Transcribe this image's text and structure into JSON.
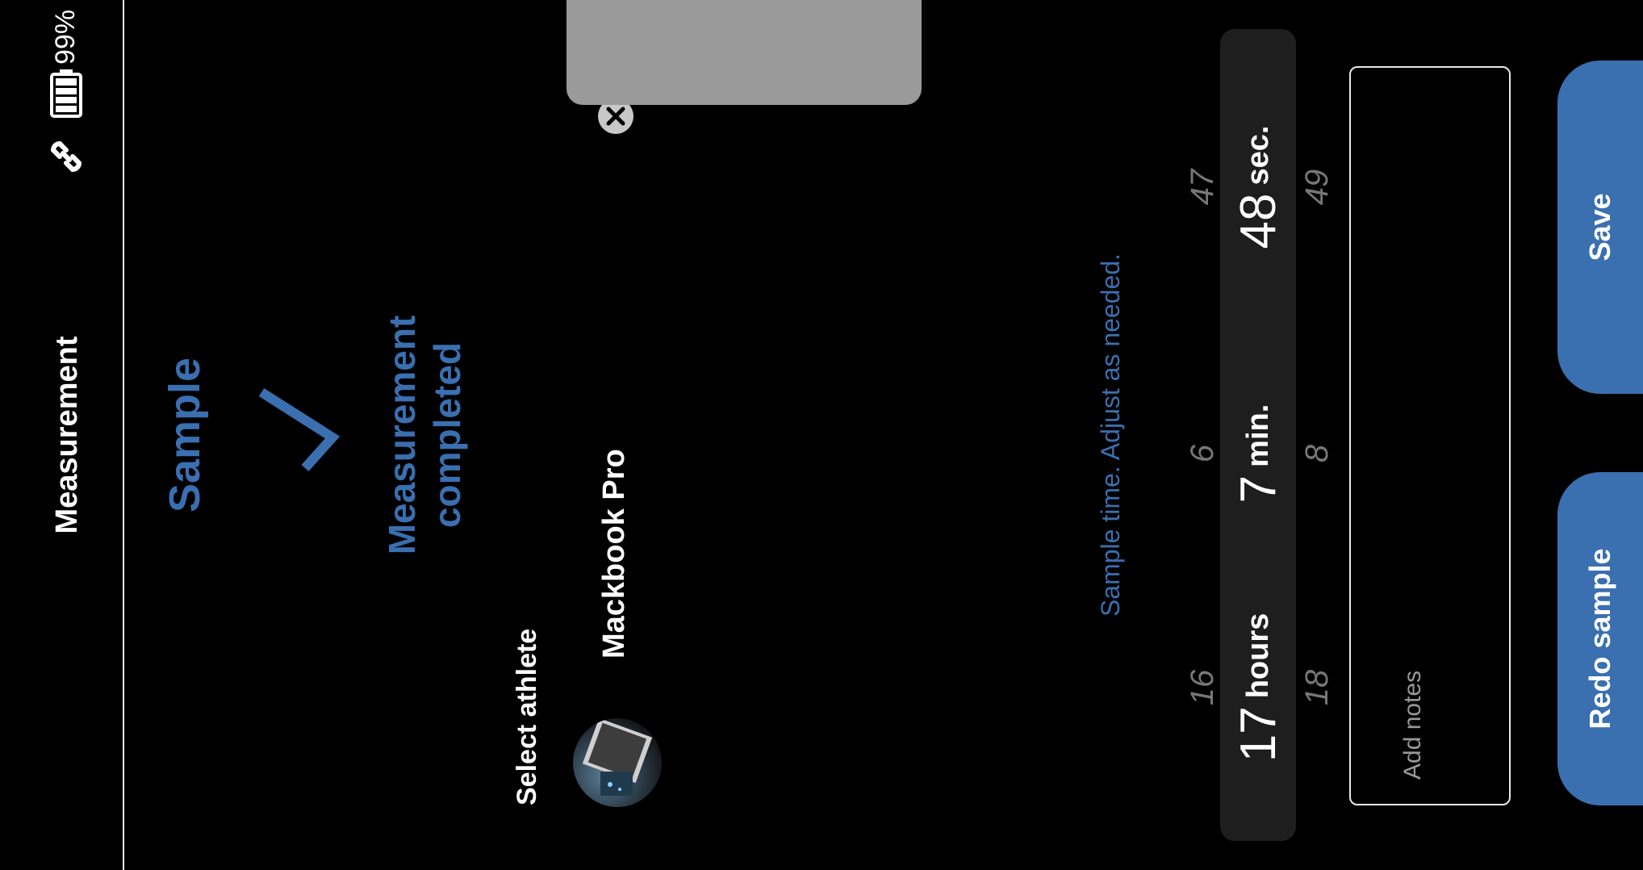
{
  "status_bar": {
    "battery_percent": "99%",
    "icons": [
      "link-icon",
      "battery-icon"
    ]
  },
  "header": {
    "title": "Measurement"
  },
  "sample": {
    "title": "Sample",
    "status_icon": "checkmark-icon",
    "status_line1": "Measurement",
    "status_line2": "completed",
    "accent_color": "#3a6fb0"
  },
  "athlete": {
    "label": "Select athlete",
    "name": "Mackbook Pro",
    "clear_icon": "clear-icon"
  },
  "time_picker": {
    "hint": "Sample time. Adjust as needed.",
    "hours": {
      "prev": "16",
      "value": "17",
      "next": "18",
      "unit": "hours"
    },
    "minutes": {
      "prev": "6",
      "value": "7",
      "next": "8",
      "unit": "min."
    },
    "seconds": {
      "prev": "47",
      "value": "48",
      "next": "49",
      "unit": "sec."
    }
  },
  "notes": {
    "placeholder": "Add notes"
  },
  "actions": {
    "redo_label": "Redo sample",
    "save_label": "Save"
  }
}
